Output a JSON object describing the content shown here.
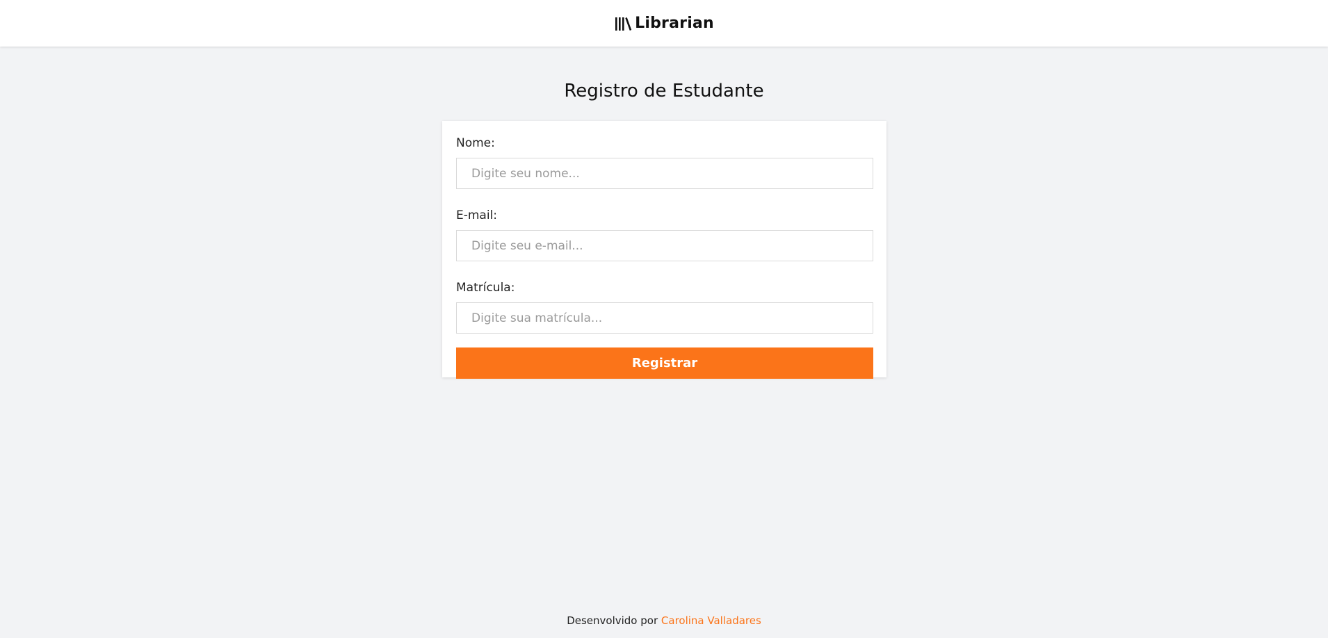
{
  "header": {
    "brand_name": "Librarian",
    "brand_icon": "library-icon"
  },
  "main": {
    "title": "Registro de Estudante",
    "form": {
      "fields": [
        {
          "label": "Nome:",
          "placeholder": "Digite seu nome...",
          "value": ""
        },
        {
          "label": "E-mail:",
          "placeholder": "Digite seu e-mail...",
          "value": ""
        },
        {
          "label": "Matrícula:",
          "placeholder": "Digite sua matrícula...",
          "value": ""
        }
      ],
      "submit_label": "Registrar"
    }
  },
  "footer": {
    "prefix": "Desenvolvido por",
    "author": "Carolina Valladares"
  },
  "colors": {
    "accent": "#fb7419",
    "background": "#f2f3f5",
    "surface": "#ffffff"
  }
}
